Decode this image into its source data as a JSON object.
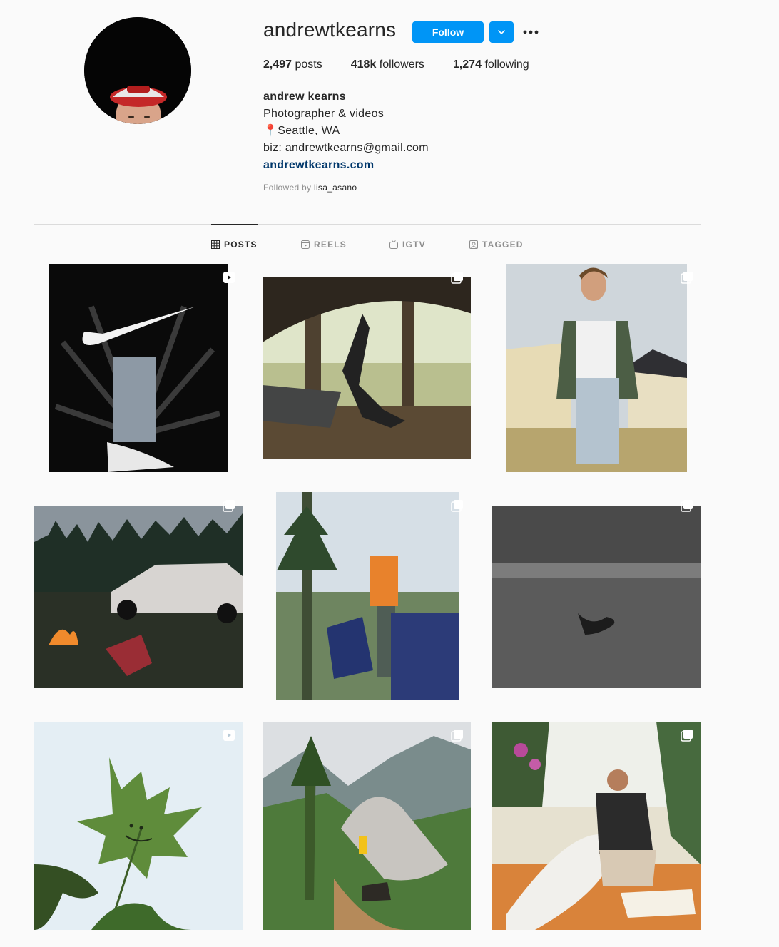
{
  "profile": {
    "username": "andrewtkearns",
    "follow_label": "Follow",
    "stats": {
      "posts_count": "2,497",
      "posts_label": "posts",
      "followers_count": "418k",
      "followers_label": "followers",
      "following_count": "1,274",
      "following_label": "following"
    },
    "bio": {
      "full_name": "andrew kearns",
      "line1": "Photographer & videos",
      "location_pin": "📍",
      "line2": "Seattle, WA",
      "line3": "biz: andrewtkearns@gmail.com",
      "website": "andrewtkearns.com"
    },
    "followed_by_prefix": "Followed by",
    "followed_by_user": "lisa_asano"
  },
  "tabs": [
    {
      "label": "POSTS",
      "icon": "grid-icon",
      "active": true
    },
    {
      "label": "REELS",
      "icon": "reels-icon",
      "active": false
    },
    {
      "label": "IGTV",
      "icon": "igtv-icon",
      "active": false
    },
    {
      "label": "TAGGED",
      "icon": "tagged-icon",
      "active": false
    }
  ],
  "colors": {
    "accent": "#0095f6",
    "background": "#fafafa",
    "link": "#00376b"
  },
  "posts": [
    {
      "subject": "nike-swoosh-sneaker",
      "badge": "reel-icon"
    },
    {
      "subject": "woman-under-rock-overhang",
      "badge": "carousel-icon"
    },
    {
      "subject": "man-walking-in-field",
      "badge": "carousel-icon"
    },
    {
      "subject": "truck-campfire-forest",
      "badge": "carousel-icon"
    },
    {
      "subject": "man-by-car-mountain-view",
      "badge": "carousel-icon"
    },
    {
      "subject": "underwater-swimmer",
      "badge": "carousel-icon"
    },
    {
      "subject": "maple-leaf-sky",
      "badge": "reel-icon"
    },
    {
      "subject": "bouldering-forest-valley",
      "badge": "carousel-icon"
    },
    {
      "subject": "woman-drawing-on-surfboard",
      "badge": "carousel-icon"
    }
  ]
}
